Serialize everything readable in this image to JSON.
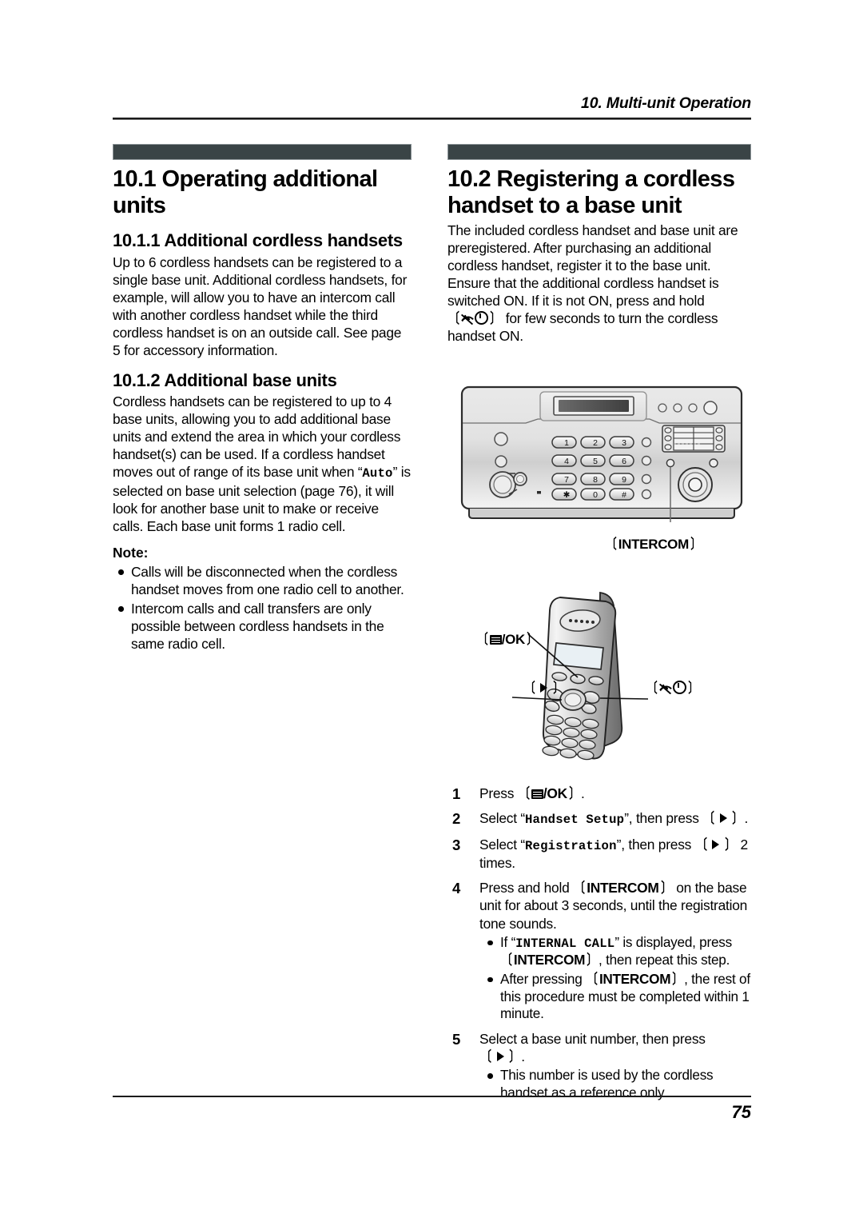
{
  "running_head": "10. Multi-unit Operation",
  "page_number": "75",
  "colors": {
    "section_bar": "#3a4446",
    "rule": "#1b1b1b"
  },
  "left_column": {
    "section": {
      "number": "10.1",
      "title": "10.1 Operating additional units"
    },
    "sub1": {
      "title": "10.1.1 Additional cordless handsets",
      "body": "Up to 6 cordless handsets can be registered to a single base unit. Additional cordless handsets, for example, will allow you to have an intercom call with another cordless handset while the third cordless handset is on an outside call. See page 5 for accessory information."
    },
    "sub2": {
      "title": "10.1.2 Additional base units",
      "body_part1": "Cordless handsets can be registered to up to 4 base units, allowing you to add additional base units and extend the area in which your cordless handset(s) can be used. If a cordless handset moves out of range of its base unit when “",
      "body_mono": "Auto",
      "body_part2": "” is selected on base unit selection (page 76), it will look for another base unit to make or receive calls. Each base unit forms 1 radio cell."
    },
    "note": {
      "label": "Note:",
      "items": [
        "Calls will be disconnected when the cordless handset moves from one radio cell to another.",
        "Intercom calls and call transfers are only possible between cordless handsets in the same radio cell."
      ]
    }
  },
  "right_column": {
    "section": {
      "number": "10.2",
      "title": "10.2 Registering a cordless handset to a base unit"
    },
    "intro_part1": "The included cordless handset and base unit are preregistered. After purchasing an additional cordless handset, register it to the base unit. Ensure that the additional cordless handset is switched ON. If it is not ON, press and hold ",
    "intro_key": "power-key",
    "intro_part2": " for few seconds to turn the cordless handset ON.",
    "figures": {
      "base_unit": {
        "name": "base-unit-illustration",
        "caption": "〔INTERCOM〕",
        "keypad": [
          "1",
          "2",
          "3",
          "4",
          "5",
          "6",
          "7",
          "8",
          "9",
          "✱",
          "0",
          "#"
        ]
      },
      "handset": {
        "name": "cordless-handset-illustration",
        "label_menu_ok": "/OK",
        "label_right": "right-arrow-key",
        "label_power": "power-key"
      }
    },
    "steps": [
      {
        "num": "1",
        "parts": [
          {
            "t": "text",
            "v": "Press "
          },
          {
            "t": "key-menu-ok"
          },
          {
            "t": "text",
            "v": "."
          }
        ]
      },
      {
        "num": "2",
        "parts": [
          {
            "t": "text",
            "v": "Select “"
          },
          {
            "t": "mono",
            "v": "Handset Setup"
          },
          {
            "t": "text",
            "v": "”, then press "
          },
          {
            "t": "key-right"
          },
          {
            "t": "text",
            "v": "."
          }
        ]
      },
      {
        "num": "3",
        "parts": [
          {
            "t": "text",
            "v": "Select “"
          },
          {
            "t": "mono",
            "v": "Registration"
          },
          {
            "t": "text",
            "v": "”, then press "
          },
          {
            "t": "key-right"
          },
          {
            "t": "text",
            "v": " 2 times."
          }
        ]
      },
      {
        "num": "4",
        "parts": [
          {
            "t": "text",
            "v": "Press and hold "
          },
          {
            "t": "key-intercom"
          },
          {
            "t": "text",
            "v": " on the base unit for about 3 seconds, until the registration tone sounds."
          }
        ],
        "bullets": [
          [
            {
              "t": "text",
              "v": "If “"
            },
            {
              "t": "mono",
              "v": "INTERNAL CALL"
            },
            {
              "t": "text",
              "v": "” is displayed, press "
            },
            {
              "t": "key-intercom"
            },
            {
              "t": "text",
              "v": ", then repeat this step."
            }
          ],
          [
            {
              "t": "text",
              "v": "After pressing "
            },
            {
              "t": "key-intercom"
            },
            {
              "t": "text",
              "v": ", the rest of this procedure must be completed within 1 minute."
            }
          ]
        ]
      },
      {
        "num": "5",
        "parts": [
          {
            "t": "text",
            "v": "Select a base unit number, then press "
          },
          {
            "t": "key-right"
          },
          {
            "t": "text",
            "v": "."
          }
        ],
        "bullets": [
          [
            {
              "t": "text",
              "v": "This number is used by the cordless handset as a reference only."
            }
          ]
        ]
      }
    ],
    "key_labels": {
      "intercom": "INTERCOM",
      "ok": "/OK",
      "bracket_open": "〔",
      "bracket_close": "〕"
    }
  }
}
